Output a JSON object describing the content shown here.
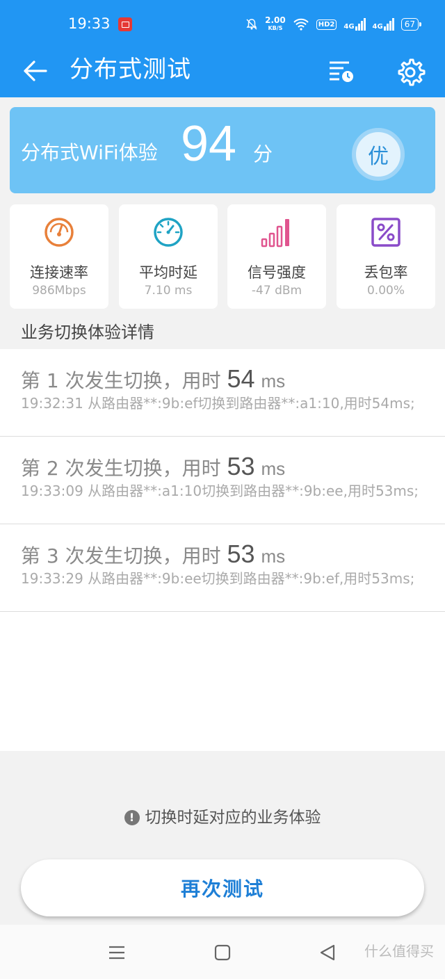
{
  "status_bar": {
    "time": "19:33",
    "net_speed": "2.00",
    "net_unit": "KB/S",
    "hd_badge": "HD2",
    "sim1": "4G",
    "sim2": "4G",
    "battery": "67"
  },
  "app_bar": {
    "title": "分布式测试"
  },
  "score": {
    "label": "分布式WiFi体验",
    "value": "94",
    "unit": "分",
    "grade": "优"
  },
  "metrics": [
    {
      "name": "连接速率",
      "value": "986Mbps",
      "icon": "speedometer-icon",
      "color": "#e8803a"
    },
    {
      "name": "平均时延",
      "value": "7.10 ms",
      "icon": "timer-icon",
      "color": "#1fa3c4"
    },
    {
      "name": "信号强度",
      "value": "-47 dBm",
      "icon": "signal-bars-icon",
      "color": "#e0558f"
    },
    {
      "name": "丢包率",
      "value": "0.00%",
      "icon": "percent-icon",
      "color": "#8a4bc9"
    }
  ],
  "section_title": "业务切换体验详情",
  "handovers": [
    {
      "prefix": "第 1 次发生切换，用时",
      "ms": "54",
      "unit": "ms",
      "detail": "19:32:31 从路由器**:9b:ef切换到路由器**:a1:10,用时54ms;"
    },
    {
      "prefix": "第 2 次发生切换，用时",
      "ms": "53",
      "unit": "ms",
      "detail": "19:33:09 从路由器**:a1:10切换到路由器**:9b:ee,用时53ms;"
    },
    {
      "prefix": "第 3 次发生切换，用时",
      "ms": "53",
      "unit": "ms",
      "detail": "19:33:29 从路由器**:9b:ee切换到路由器**:9b:ef,用时53ms;"
    }
  ],
  "note": "切换时延对应的业务体验",
  "retest_button": "再次测试",
  "watermark": "什么值得买",
  "colors": {
    "primary": "#2196f3",
    "score_card": "#6ec3f5",
    "button_text": "#1e7fd6"
  }
}
